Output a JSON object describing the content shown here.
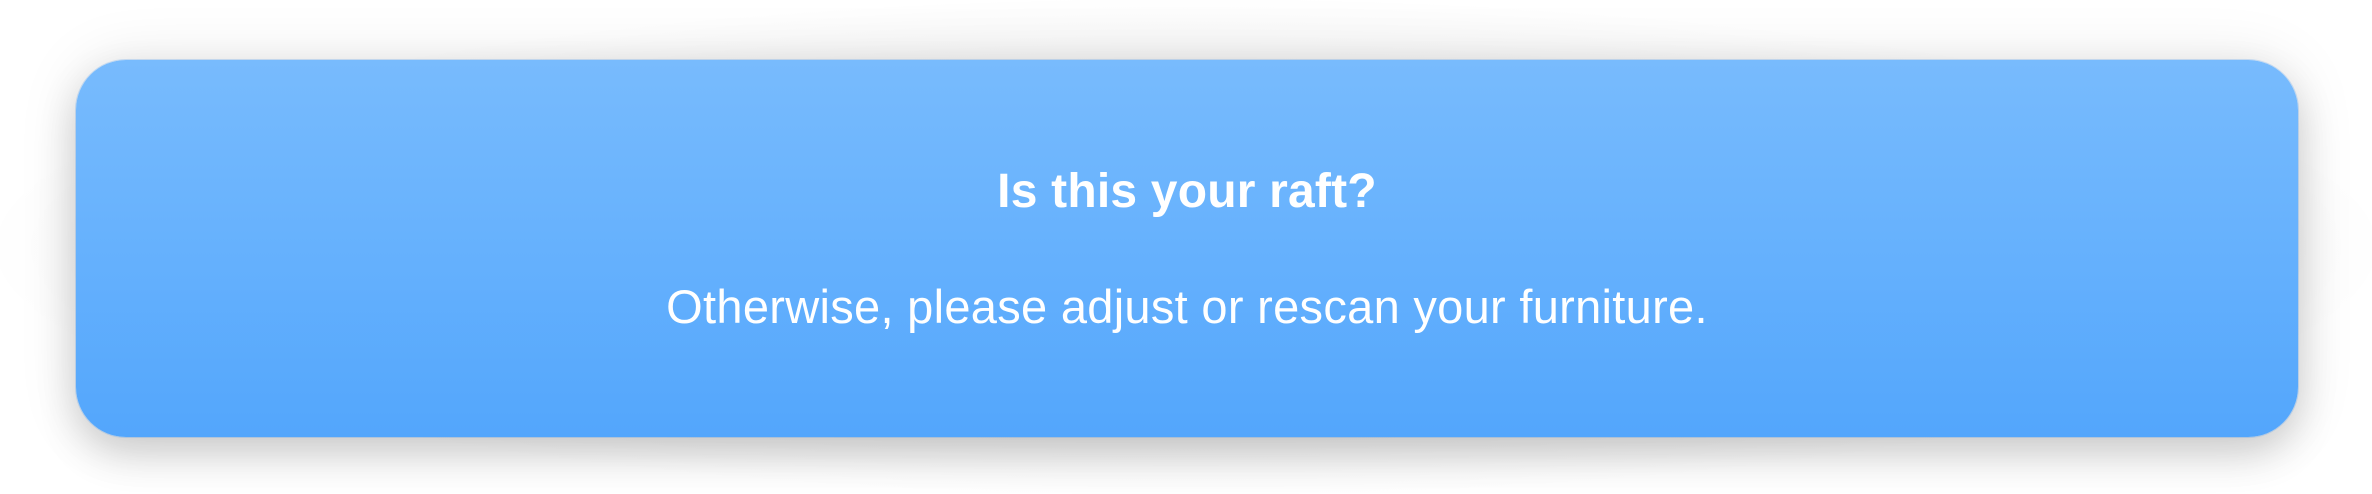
{
  "prompt": {
    "title": "Is this your raft?",
    "message": "Otherwise, please adjust or rescan your furniture."
  },
  "colors": {
    "banner_top": "#78bbfd",
    "banner_bottom": "#53a6fc",
    "text": "#ffffff"
  }
}
